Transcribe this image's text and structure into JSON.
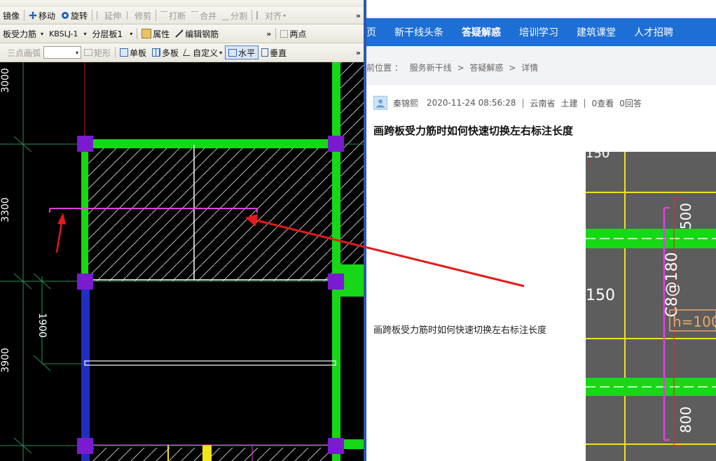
{
  "cad": {
    "toolbar1": {
      "mirror": "镜像",
      "move": "移动",
      "rotate": "旋转",
      "extend": "延伸",
      "trim": "修剪",
      "break": "打断",
      "merge": "合并",
      "split": "分割",
      "align": "对齐"
    },
    "toolbar2": {
      "component_type": "板受力筋",
      "component_name": "KBSLJ-1",
      "layer": "分层板1",
      "properties": "属性",
      "edit_rebar": "编辑钢筋",
      "two_points": "两点"
    },
    "toolbar3": {
      "three_point_arc": "三点画弧",
      "rect": "矩形",
      "single_slab": "单板",
      "multi_slab": "多板",
      "custom": "自定义",
      "horizontal": "水平",
      "vertical": "垂直"
    },
    "dimensions": {
      "d1": "3000",
      "d2": "3300",
      "d3": "1900",
      "d4": "3900"
    }
  },
  "web": {
    "nav": [
      "页",
      "新干线头条",
      "答疑解惑",
      "培训学习",
      "建筑课堂",
      "人才招聘"
    ],
    "nav_active": 2,
    "breadcrumb": {
      "prefix": "前位置 ：",
      "items": [
        "服务新干线",
        "答疑解惑",
        "详情"
      ],
      "sep": ">"
    },
    "meta": {
      "user": "秦锦熙",
      "time": "2020-11-24 08:56:28",
      "region": "云南省",
      "discipline": "土建",
      "views": "0查看",
      "answers": "0回答"
    },
    "question_title": "画跨板受力筋时如何快速切换左右标注长度",
    "question_body": "画跨板受力筋时如何快速切换左右标注长度",
    "attachment_labels": {
      "top": "150",
      "left_mid": "150",
      "dim_top": "500",
      "rebar": "C8@180",
      "h": "h=100",
      "dim_bottom": "800"
    }
  },
  "colors": {
    "nav_bg": "#1d6fd6",
    "annotation_arrow": "#e21b1b",
    "slab_rebar": "#e040e0",
    "beam_green": "#16d816",
    "column_purple": "#7a1bd0"
  }
}
